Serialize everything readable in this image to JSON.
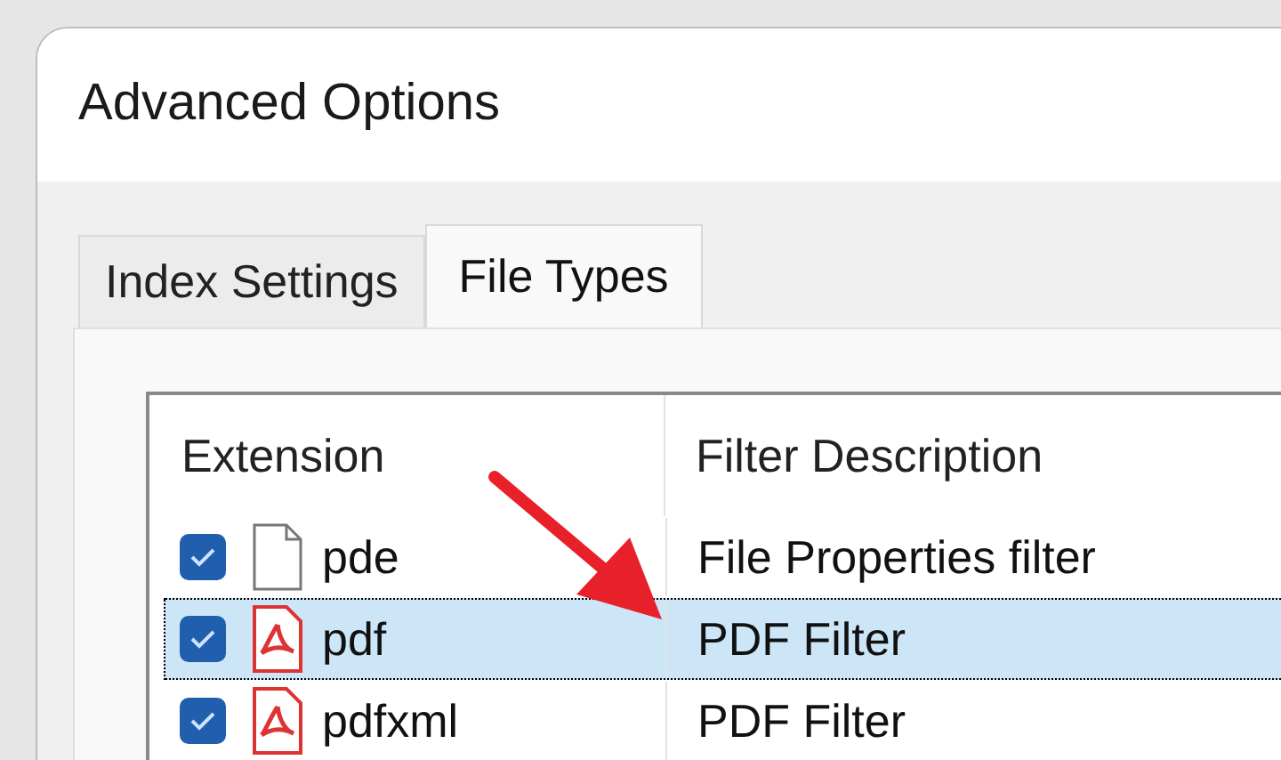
{
  "window": {
    "title": "Advanced Options"
  },
  "tabs": [
    {
      "label": "Index Settings",
      "selected": false
    },
    {
      "label": "File Types",
      "selected": true
    }
  ],
  "table": {
    "columns": [
      "Extension",
      "Filter Description"
    ],
    "rows": [
      {
        "kind": "document",
        "checked": true,
        "selected": false,
        "extension": "pde",
        "description": "File Properties filter"
      },
      {
        "kind": "pdf",
        "checked": true,
        "selected": true,
        "extension": "pdf",
        "description": "PDF Filter"
      },
      {
        "kind": "pdf",
        "checked": true,
        "selected": false,
        "extension": "pdfxml",
        "description": "PDF Filter"
      }
    ]
  }
}
